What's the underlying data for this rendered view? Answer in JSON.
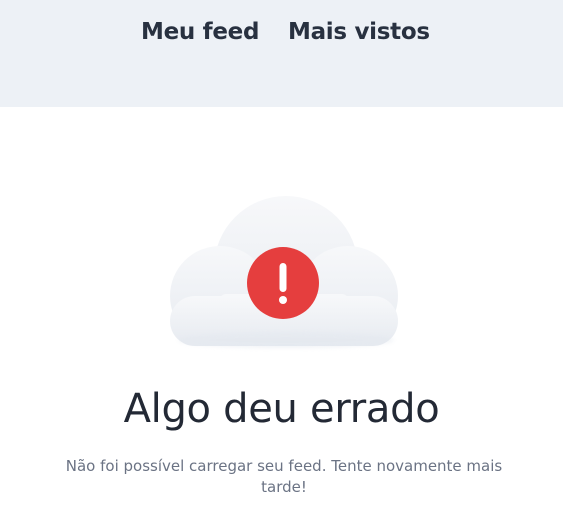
{
  "nav": {
    "tabs": [
      {
        "label": "Meu feed"
      },
      {
        "label": "Mais vistos"
      }
    ]
  },
  "error": {
    "icon": "exclamation-icon",
    "title": "Algo deu errado",
    "message": "Não foi possível carregar seu feed. Tente novamente mais tarde!"
  },
  "colors": {
    "nav_background": "#edf1f6",
    "alert_red": "#e53e3e",
    "title_text": "#232935",
    "body_text": "#6b7384"
  }
}
